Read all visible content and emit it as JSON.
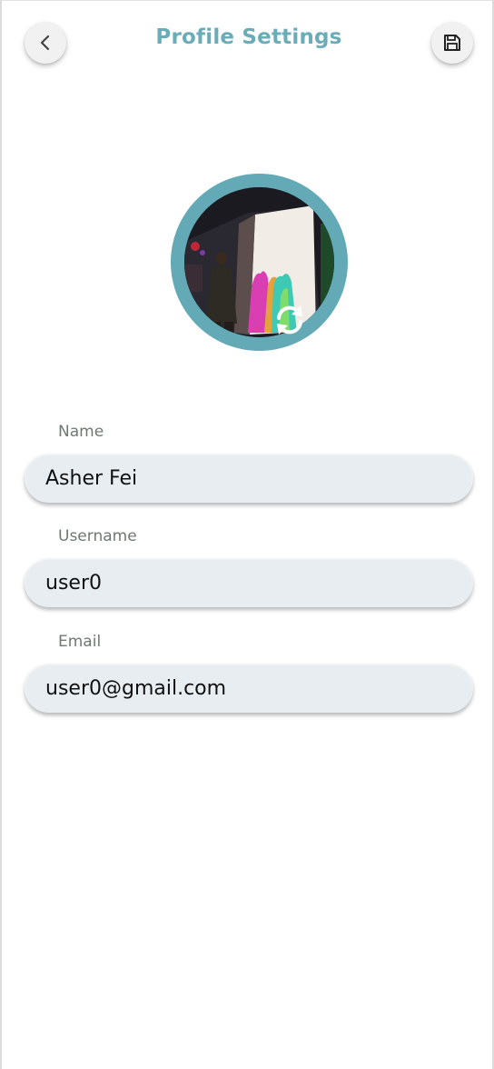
{
  "header": {
    "title": "Profile Settings",
    "back_icon": "chevron-left-icon",
    "save_icon": "floppy-disk-icon"
  },
  "avatar": {
    "ring_color": "#63aab6",
    "change_icon": "refresh-icon"
  },
  "form": {
    "name": {
      "label": "Name",
      "value": "Asher Fei"
    },
    "username": {
      "label": "Username",
      "value": "user0"
    },
    "email": {
      "label": "Email",
      "value": "user0@gmail.com"
    }
  },
  "colors": {
    "accent": "#6aadb8",
    "field_bg": "#e8edf1",
    "label": "#6d7a70"
  }
}
